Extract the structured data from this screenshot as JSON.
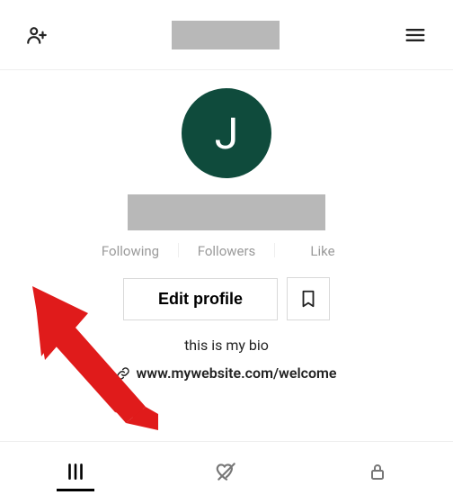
{
  "topbar": {
    "add_friend_icon": "add-friend",
    "menu_icon": "hamburger"
  },
  "profile": {
    "avatar_initial": "J",
    "stats": {
      "following_label": "Following",
      "followers_label": "Followers",
      "like_label": "Like"
    },
    "edit_profile_label": "Edit profile",
    "bio_text": "this is my bio",
    "bio_link_text": "www.mywebsite.com/welcome"
  },
  "tabs": {
    "feed": "feed",
    "liked": "liked",
    "private": "private",
    "active": "feed"
  }
}
